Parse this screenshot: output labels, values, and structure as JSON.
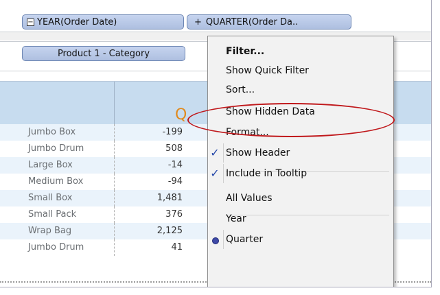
{
  "columns_shelf": {
    "year_pill": {
      "icon": "minus-box-icon",
      "label": "YEAR(Order Date)"
    },
    "quarter_pill": {
      "icon": "plus-icon",
      "label": "QUARTER(Order Da.."
    }
  },
  "rows_shelf": {
    "category_pill": {
      "label": "Product 1 - Category"
    }
  },
  "table": {
    "header_peek": "Q",
    "rows": [
      {
        "name": "Jumbo Box",
        "value": "-199"
      },
      {
        "name": "Jumbo Drum",
        "value": "508"
      },
      {
        "name": "Large Box",
        "value": "-14"
      },
      {
        "name": "Medium Box",
        "value": "-94"
      },
      {
        "name": "Small Box",
        "value": "1,481"
      },
      {
        "name": "Small Pack",
        "value": "376"
      },
      {
        "name": "Wrap Bag",
        "value": "2,125"
      },
      {
        "name": "Jumbo Drum",
        "value": "41"
      }
    ]
  },
  "context_menu": {
    "items": [
      {
        "label": "Filter...",
        "bold": true,
        "checked": false
      },
      {
        "label": "Show Quick Filter",
        "checked": false
      },
      {
        "label": "Sort...",
        "checked": false
      },
      {
        "label": "Show Hidden Data",
        "checked": false,
        "highlighted": true
      },
      {
        "label": "Format...",
        "checked": false
      },
      {
        "label": "Show Header",
        "checked": true
      },
      {
        "label": "Include in Tooltip",
        "checked": true
      },
      {
        "label": "All Values",
        "checked": false
      },
      {
        "label": "Year",
        "checked": false
      },
      {
        "label": "Quarter",
        "radio_selected": true
      }
    ]
  },
  "colors": {
    "pill_fill": "#b7c7e8",
    "header_band": "#c7dcef",
    "alt_row": "#eaf3fb",
    "highlight_ellipse": "#c0181b",
    "check_mark": "#2346a8"
  }
}
